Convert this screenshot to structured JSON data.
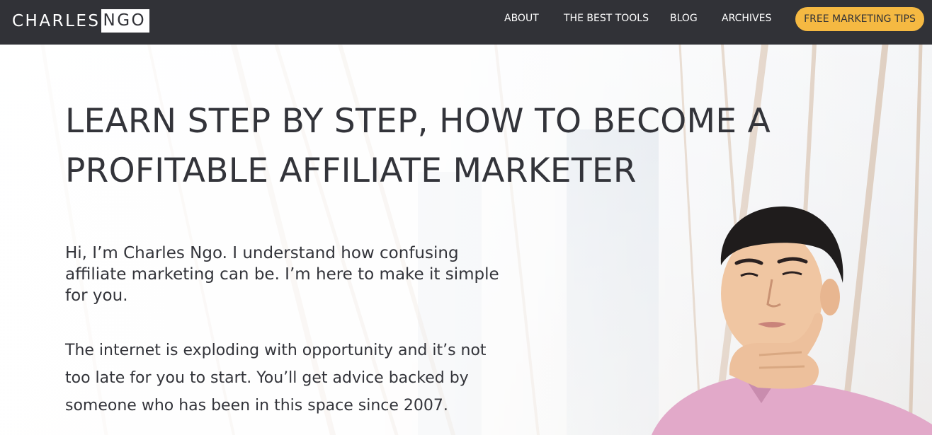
{
  "header": {
    "logo": {
      "first": "CHARLES",
      "last": "NGO"
    },
    "nav": [
      {
        "label": "ABOUT"
      },
      {
        "label": "THE BEST TOOLS"
      },
      {
        "label": "BLOG"
      },
      {
        "label": "ARCHIVES"
      }
    ],
    "cta_label": "FREE MARKETING TIPS"
  },
  "hero": {
    "headline_lines": [
      "LEARN STEP BY STEP, HOW TO BECOME A",
      "PROFITABLE AFFILIATE MARKETER"
    ],
    "intro_lines": [
      "Hi, I’m Charles Ngo. I understand how confusing",
      "affiliate marketing can be. I’m here to make it simple",
      "for you."
    ],
    "body_lines": [
      "The internet is exploding with opportunity and it’s not",
      "too late for you to start. You’ll get advice backed by",
      "someone who has been in this space since 2007."
    ]
  },
  "colors": {
    "header_bg": "#313237",
    "cta_bg": "#f5b942",
    "text": "#33343a"
  },
  "icons": [
    "charles-ngo-logo",
    "portrait-photo"
  ]
}
